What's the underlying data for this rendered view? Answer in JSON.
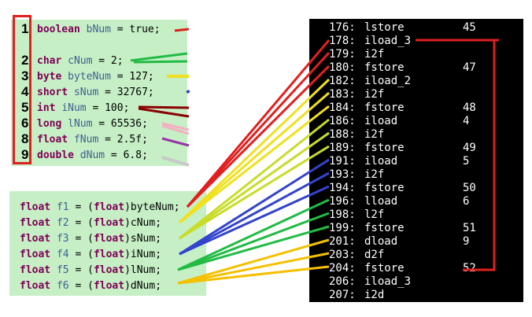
{
  "top_code": [
    {
      "num": "1",
      "type": "boolean",
      "name": "bNum",
      "value": " = true;"
    },
    {
      "num": "2",
      "type": "char",
      "name": "cNum",
      "value": " = 2;"
    },
    {
      "num": "3",
      "type": "byte",
      "name": "byteNum",
      "value": " = 127;"
    },
    {
      "num": "4",
      "type": "short",
      "name": "sNum",
      "value": " = 32767;"
    },
    {
      "num": "5",
      "type": "int",
      "name": "iNum",
      "value": " = 100;"
    },
    {
      "num": "6",
      "type": "long",
      "name": "lNum",
      "value": " = 65536;"
    },
    {
      "num": "8",
      "type": "float",
      "name": "fNum",
      "value": " = 2.5f;"
    },
    {
      "num": "9",
      "type": "double",
      "name": "dNum",
      "value": " = 6.8;"
    }
  ],
  "bottom_code": [
    {
      "type": "float",
      "name": "f1",
      "eq": " = (",
      "cast": "float",
      "src": ")byteNum;"
    },
    {
      "type": "float",
      "name": "f2",
      "eq": " = (",
      "cast": "float",
      "src": ")cNum;"
    },
    {
      "type": "float",
      "name": "f3",
      "eq": " = (",
      "cast": "float",
      "src": ")sNum;"
    },
    {
      "type": "float",
      "name": "f4",
      "eq": " = (",
      "cast": "float",
      "src": ")iNum;"
    },
    {
      "type": "float",
      "name": "f5",
      "eq": " = (",
      "cast": "float",
      "src": ")lNum;"
    },
    {
      "type": "float",
      "name": "f6",
      "eq": " = (",
      "cast": "float",
      "src": ")dNum;"
    }
  ],
  "bytecode": [
    {
      "off": "176:",
      "op": "lstore",
      "arg": "45"
    },
    {
      "off": "178:",
      "op": "iload_3",
      "arg": ""
    },
    {
      "off": "179:",
      "op": "i2f",
      "arg": ""
    },
    {
      "off": "180:",
      "op": "fstore",
      "arg": "47"
    },
    {
      "off": "182:",
      "op": "iload_2",
      "arg": ""
    },
    {
      "off": "183:",
      "op": "i2f",
      "arg": ""
    },
    {
      "off": "184:",
      "op": "fstore",
      "arg": "48"
    },
    {
      "off": "186:",
      "op": "iload",
      "arg": "4"
    },
    {
      "off": "188:",
      "op": "i2f",
      "arg": ""
    },
    {
      "off": "189:",
      "op": "fstore",
      "arg": "49"
    },
    {
      "off": "191:",
      "op": "iload",
      "arg": "5"
    },
    {
      "off": "193:",
      "op": "i2f",
      "arg": ""
    },
    {
      "off": "194:",
      "op": "fstore",
      "arg": "50"
    },
    {
      "off": "196:",
      "op": "lload",
      "arg": "6"
    },
    {
      "off": "198:",
      "op": "l2f",
      "arg": ""
    },
    {
      "off": "199:",
      "op": "fstore",
      "arg": "51"
    },
    {
      "off": "201:",
      "op": "dload",
      "arg": "9"
    },
    {
      "off": "203:",
      "op": "d2f",
      "arg": ""
    },
    {
      "off": "204:",
      "op": "fstore",
      "arg": "52"
    },
    {
      "off": "206:",
      "op": "iload_3",
      "arg": ""
    },
    {
      "off": "207:",
      "op": "i2d",
      "arg": ""
    }
  ],
  "colors": {
    "red": "#e02020",
    "green": "#22bb44",
    "yellow": "#f0e020",
    "blue": "#3344cc",
    "darkred": "#8b0000",
    "pink": "#f4b0c0",
    "purple": "#9933aa",
    "gray": "#c8c8c8",
    "orange": "#f5c000",
    "yellowgreen": "#c8dc28"
  }
}
